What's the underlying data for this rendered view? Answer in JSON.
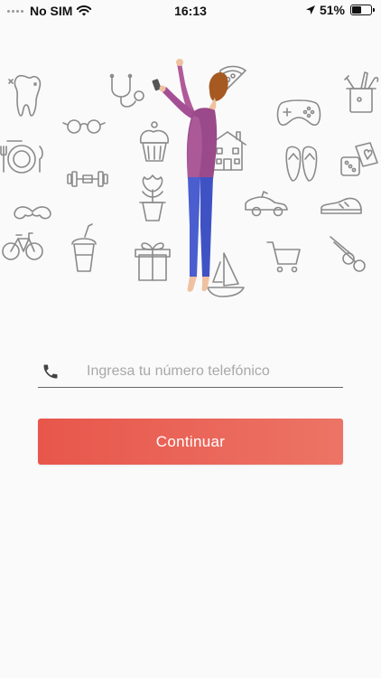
{
  "status_bar": {
    "carrier": "No SIM",
    "time": "16:13",
    "battery": "51%",
    "battery_level": 0.51,
    "icons": [
      "signal-dots-icon",
      "wifi-icon",
      "location-arrow-icon",
      "battery-icon"
    ]
  },
  "illustration": {
    "icons": [
      "tooth-icon",
      "stethoscope-icon",
      "pizza-icon",
      "tools-cup-icon",
      "glasses-icon",
      "cupcake-icon",
      "house-icon",
      "gamepad-icon",
      "plate-cutlery-icon",
      "dumbbell-icon",
      "flip-flops-icon",
      "dice-cards-icon",
      "mustache-icon",
      "flower-pot-icon",
      "car-icon",
      "shoe-icon",
      "bicycle-icon",
      "drink-cup-icon",
      "gift-icon",
      "boat-icon",
      "shopping-cart-icon",
      "scissors-icon",
      "person-icon"
    ]
  },
  "login": {
    "phone_placeholder": "Ingresa tu número telefónico",
    "phone_value": "",
    "continue_label": "Continuar"
  },
  "colors": {
    "accent": "#e8564b",
    "accent_light": "#ec7466",
    "icon_stroke": "#8a8a8a",
    "person_shirt": "#9a4a8a",
    "person_pants": "#4a5ed0"
  }
}
